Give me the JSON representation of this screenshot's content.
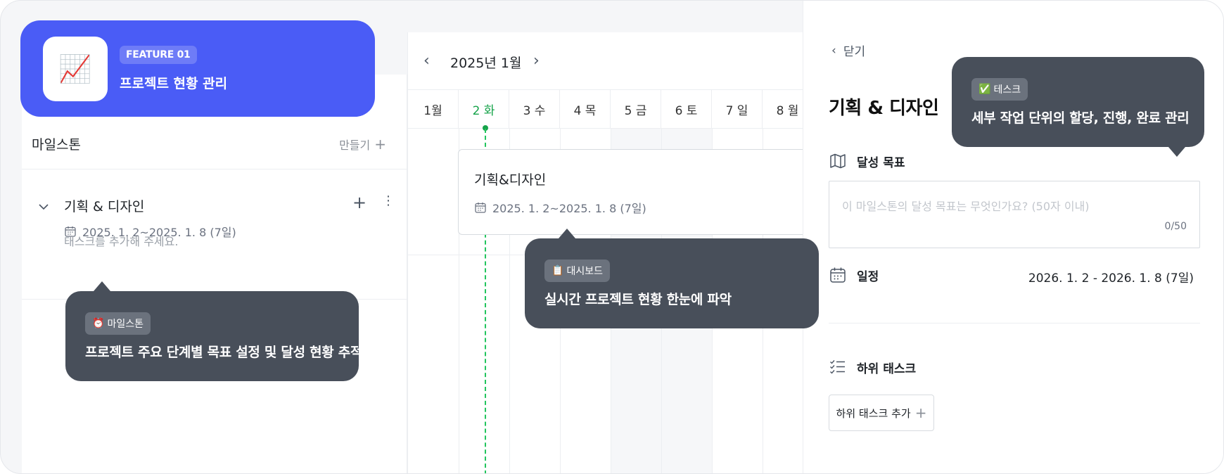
{
  "banner": {
    "icon": "chart-increasing-emoji",
    "icon_glyph": "📈",
    "badge": "FEATURE 01",
    "title": "프로젝트 현황 관리"
  },
  "milestones": {
    "title": "마일스톤",
    "create_label": "만들기",
    "item": {
      "name": "기획 & 디자인",
      "date": "2025. 1. 2~2025. 1. 8 (7일)",
      "empty_text": "태스크를 추가해 주세요."
    }
  },
  "gantt": {
    "month_label": "2025년 1월",
    "days": [
      "1월",
      "2 화",
      "3 수",
      "4 목",
      "5 금",
      "6 토",
      "7 일",
      "8 월"
    ],
    "today_index": 1,
    "task": {
      "name": "기획&디자인",
      "date": "2025. 1. 2~2025. 1. 8 (7일)"
    }
  },
  "detail": {
    "close_label": "닫기",
    "title": "기획 & 디자인",
    "goal_label": "달성 목표",
    "goal_placeholder": "이 마일스톤의 달성 목표는 무엇인가요? (50자 이내)",
    "goal_count": "0/50",
    "schedule_label": "일정",
    "schedule_value": "2026. 1. 2 - 2026. 1. 8 (7일)",
    "subtask_label": "하위 태스크",
    "subtask_add_label": "하위 태스크 추가"
  },
  "tooltips": {
    "milestone": {
      "emoji": "⏰",
      "badge": "마일스톤",
      "text": "프로젝트 주요 단계별 목표 설정 및 달성 현황 추적"
    },
    "dashboard": {
      "emoji": "📋",
      "badge": "대시보드",
      "text": "실시간 프로젝트 현황 한눈에 파악"
    },
    "task": {
      "emoji": "✅",
      "badge": "테스크",
      "text": "세부 작업 단위의 할당, 진행, 완료 관리"
    }
  },
  "colors": {
    "brand_blue": "#4a5cf6",
    "tooltip_bg": "#484f5a",
    "today_green": "#16a34a"
  }
}
